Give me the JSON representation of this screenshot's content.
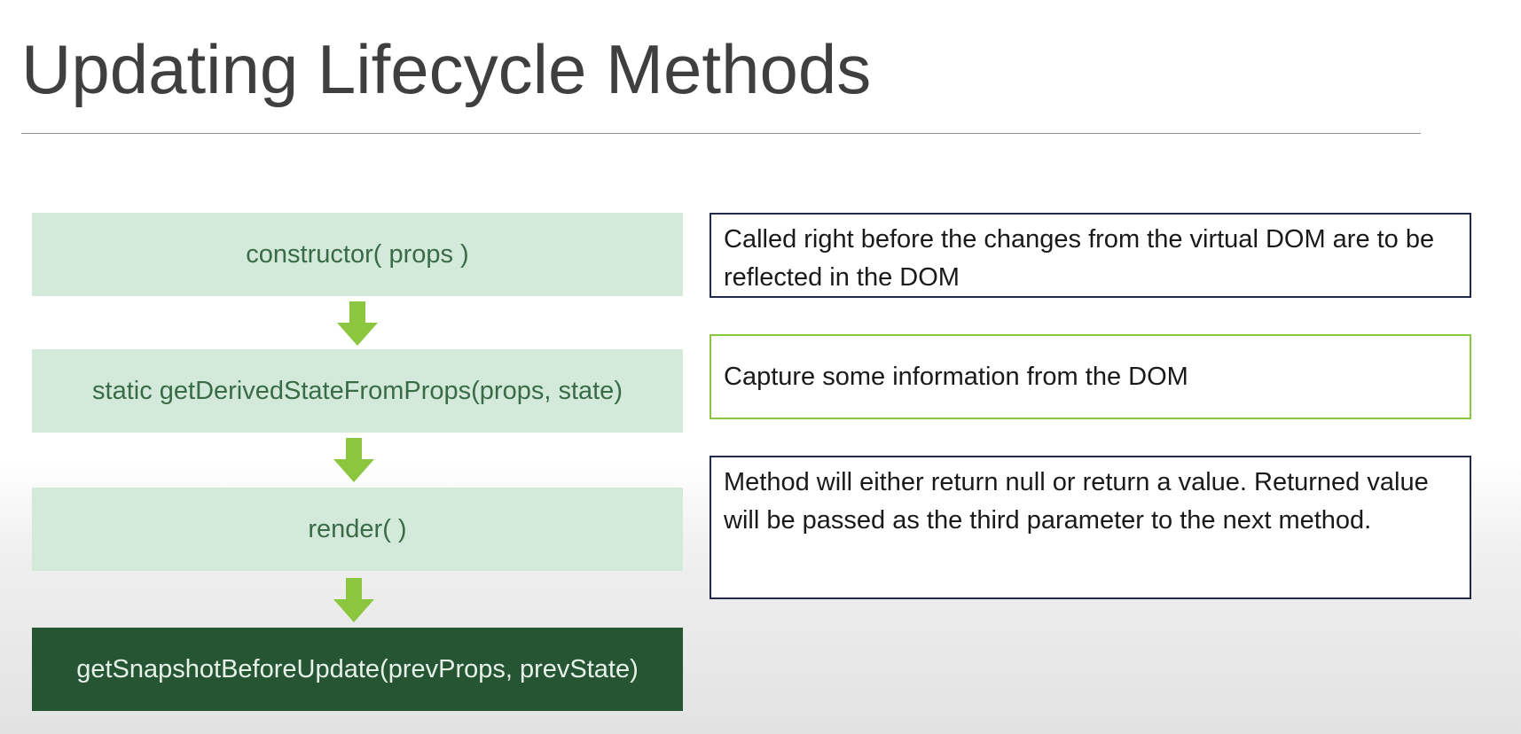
{
  "slide": {
    "title": "Updating Lifecycle Methods"
  },
  "flow": {
    "methods": [
      "constructor( props )",
      "static getDerivedStateFromProps(props, state)",
      "render( )",
      "getSnapshotBeforeUpdate(prevProps, prevState)"
    ],
    "active_method": "getSnapshotBeforeUpdate(prevProps, prevState)"
  },
  "descriptions": [
    "Called right before the changes from the virtual DOM are to be reflected in the DOM",
    "Capture some information from the DOM",
    "Method will either return null or return a value. Returned value will be passed as the third parameter to the next method."
  ],
  "colors": {
    "box_fill": "#d3eadb",
    "box_text": "#3a6b47",
    "active_fill": "#265534",
    "active_text": "#e6f1e8",
    "arrow": "#8cc63f",
    "desc_border": "#22294a",
    "desc_highlight_border": "#8cc63f"
  }
}
